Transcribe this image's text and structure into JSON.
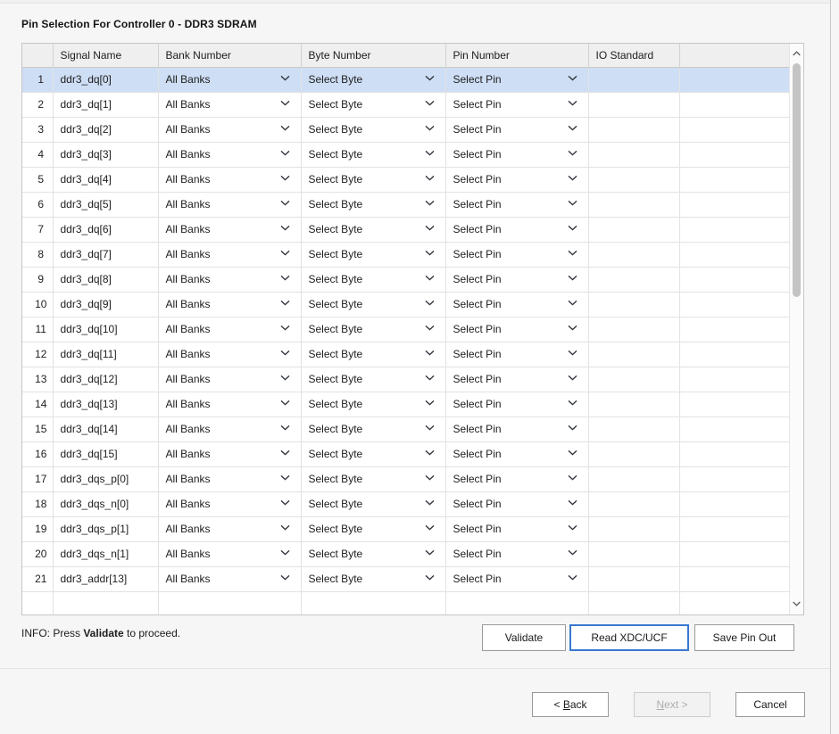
{
  "page_title": "Pin Selection For Controller 0 - DDR3 SDRAM",
  "table": {
    "headers": {
      "index": "",
      "signal_name": "Signal Name",
      "bank_number": "Bank Number",
      "byte_number": "Byte Number",
      "pin_number": "Pin Number",
      "io_standard": "IO Standard",
      "blank": ""
    },
    "selected_row_index": 1,
    "rows": [
      {
        "index": "1",
        "signal_name": "ddr3_dq[0]",
        "bank_number": "All Banks",
        "byte_number": "Select Byte",
        "pin_number": "Select Pin",
        "io_standard": ""
      },
      {
        "index": "2",
        "signal_name": "ddr3_dq[1]",
        "bank_number": "All Banks",
        "byte_number": "Select Byte",
        "pin_number": "Select Pin",
        "io_standard": ""
      },
      {
        "index": "3",
        "signal_name": "ddr3_dq[2]",
        "bank_number": "All Banks",
        "byte_number": "Select Byte",
        "pin_number": "Select Pin",
        "io_standard": ""
      },
      {
        "index": "4",
        "signal_name": "ddr3_dq[3]",
        "bank_number": "All Banks",
        "byte_number": "Select Byte",
        "pin_number": "Select Pin",
        "io_standard": ""
      },
      {
        "index": "5",
        "signal_name": "ddr3_dq[4]",
        "bank_number": "All Banks",
        "byte_number": "Select Byte",
        "pin_number": "Select Pin",
        "io_standard": ""
      },
      {
        "index": "6",
        "signal_name": "ddr3_dq[5]",
        "bank_number": "All Banks",
        "byte_number": "Select Byte",
        "pin_number": "Select Pin",
        "io_standard": ""
      },
      {
        "index": "7",
        "signal_name": "ddr3_dq[6]",
        "bank_number": "All Banks",
        "byte_number": "Select Byte",
        "pin_number": "Select Pin",
        "io_standard": ""
      },
      {
        "index": "8",
        "signal_name": "ddr3_dq[7]",
        "bank_number": "All Banks",
        "byte_number": "Select Byte",
        "pin_number": "Select Pin",
        "io_standard": ""
      },
      {
        "index": "9",
        "signal_name": "ddr3_dq[8]",
        "bank_number": "All Banks",
        "byte_number": "Select Byte",
        "pin_number": "Select Pin",
        "io_standard": ""
      },
      {
        "index": "10",
        "signal_name": "ddr3_dq[9]",
        "bank_number": "All Banks",
        "byte_number": "Select Byte",
        "pin_number": "Select Pin",
        "io_standard": ""
      },
      {
        "index": "11",
        "signal_name": "ddr3_dq[10]",
        "bank_number": "All Banks",
        "byte_number": "Select Byte",
        "pin_number": "Select Pin",
        "io_standard": ""
      },
      {
        "index": "12",
        "signal_name": "ddr3_dq[11]",
        "bank_number": "All Banks",
        "byte_number": "Select Byte",
        "pin_number": "Select Pin",
        "io_standard": ""
      },
      {
        "index": "13",
        "signal_name": "ddr3_dq[12]",
        "bank_number": "All Banks",
        "byte_number": "Select Byte",
        "pin_number": "Select Pin",
        "io_standard": ""
      },
      {
        "index": "14",
        "signal_name": "ddr3_dq[13]",
        "bank_number": "All Banks",
        "byte_number": "Select Byte",
        "pin_number": "Select Pin",
        "io_standard": ""
      },
      {
        "index": "15",
        "signal_name": "ddr3_dq[14]",
        "bank_number": "All Banks",
        "byte_number": "Select Byte",
        "pin_number": "Select Pin",
        "io_standard": ""
      },
      {
        "index": "16",
        "signal_name": "ddr3_dq[15]",
        "bank_number": "All Banks",
        "byte_number": "Select Byte",
        "pin_number": "Select Pin",
        "io_standard": ""
      },
      {
        "index": "17",
        "signal_name": "ddr3_dqs_p[0]",
        "bank_number": "All Banks",
        "byte_number": "Select Byte",
        "pin_number": "Select Pin",
        "io_standard": ""
      },
      {
        "index": "18",
        "signal_name": "ddr3_dqs_n[0]",
        "bank_number": "All Banks",
        "byte_number": "Select Byte",
        "pin_number": "Select Pin",
        "io_standard": ""
      },
      {
        "index": "19",
        "signal_name": "ddr3_dqs_p[1]",
        "bank_number": "All Banks",
        "byte_number": "Select Byte",
        "pin_number": "Select Pin",
        "io_standard": ""
      },
      {
        "index": "20",
        "signal_name": "ddr3_dqs_n[1]",
        "bank_number": "All Banks",
        "byte_number": "Select Byte",
        "pin_number": "Select Pin",
        "io_standard": ""
      },
      {
        "index": "21",
        "signal_name": "ddr3_addr[13]",
        "bank_number": "All Banks",
        "byte_number": "Select Byte",
        "pin_number": "Select Pin",
        "io_standard": ""
      },
      {
        "index": "",
        "signal_name": "",
        "bank_number": "",
        "byte_number": "",
        "pin_number": "",
        "io_standard": ""
      }
    ]
  },
  "info": {
    "prefix": "INFO: Press ",
    "emphasis": "Validate",
    "suffix": " to proceed."
  },
  "actions": {
    "validate": "Validate",
    "read_xdc_ucf": "Read XDC/UCF",
    "save_pin_out": "Save Pin Out",
    "focused": "read_xdc_ucf"
  },
  "footer": {
    "back_prefix": "< ",
    "back_mnemonic": "B",
    "back_suffix": "ack",
    "next_mnemonic": "N",
    "next_suffix": "ext >",
    "cancel": "Cancel",
    "next_disabled": true
  },
  "colors": {
    "selection_blue": "#cedef5",
    "focus_blue": "#3a78d0",
    "header_gray": "#efefef",
    "page_bg": "#f6f6f6",
    "scrollbar_thumb": "#c4c4c4"
  },
  "scrollbar": {
    "up_arrow": "chevron-up",
    "down_arrow": "chevron-down",
    "position": "top"
  }
}
